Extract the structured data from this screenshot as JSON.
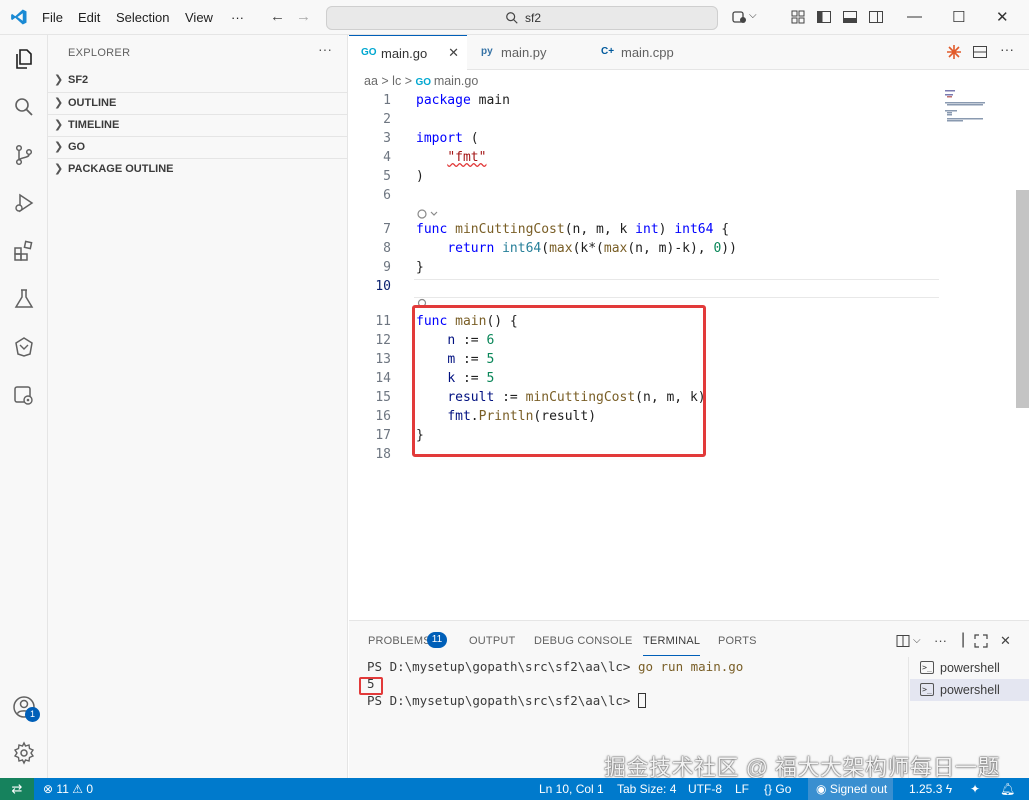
{
  "menu": {
    "file": "File",
    "edit": "Edit",
    "selection": "Selection",
    "view": "View",
    "more": "···"
  },
  "search": {
    "text": "sf2"
  },
  "sidebar": {
    "title": "EXPLORER",
    "sections": [
      "SF2",
      "OUTLINE",
      "TIMELINE",
      "GO",
      "PACKAGE OUTLINE"
    ]
  },
  "tabs": [
    {
      "label": "main.go",
      "icon": "GO"
    },
    {
      "label": "main.py",
      "icon": "py"
    },
    {
      "label": "main.cpp",
      "icon": "C+"
    }
  ],
  "breadcrumb": {
    "folder1": "aa",
    "folder2": "lc",
    "file": "main.go"
  },
  "editor": {
    "line_numbers": [
      "1",
      "2",
      "3",
      "4",
      "5",
      "6",
      "7",
      "8",
      "9",
      "10",
      "11",
      "12",
      "13",
      "14",
      "15",
      "16",
      "17",
      "18"
    ],
    "current_line": "10",
    "code": {
      "l1_kw": "package",
      "l1_rest": " main",
      "l3_kw": "import",
      "l3_rest": " (",
      "l4_str": "\"fmt\"",
      "l5": ")",
      "l7_kw": "func",
      "l7_fn": "minCuttingCost",
      "l7_args": "(n, m, k ",
      "l7_ty": "int",
      "l7_close": ") ",
      "l7_ret": "int64",
      "l7_brace": " {",
      "l8_kw": "return",
      "l8_ty": "int64",
      "l8_a": "(",
      "l8_fn1": "max",
      "l8_b": "(k*(",
      "l8_fn2": "max",
      "l8_c": "(n, m)-k), ",
      "l8_num": "0",
      "l8_d": "))",
      "l9": "}",
      "l11_kw": "func",
      "l11_fn": "main",
      "l11_rest": "() {",
      "l12_var": "n",
      "l12_op": " := ",
      "l12_num": "6",
      "l13_var": "m",
      "l13_op": " := ",
      "l13_num": "5",
      "l14_var": "k",
      "l14_op": " := ",
      "l14_num": "5",
      "l15_var": "result",
      "l15_op": " := ",
      "l15_fn": "minCuttingCost",
      "l15_rest": "(n, m, k)",
      "l16_pkg": "fmt",
      "l16_dot": ".",
      "l16_fn": "Println",
      "l16_rest": "(result)",
      "l17": "}"
    }
  },
  "panel": {
    "tabs": {
      "problems": "PROBLEMS",
      "output": "OUTPUT",
      "debug": "DEBUG CONSOLE",
      "terminal": "TERMINAL",
      "ports": "PORTS"
    },
    "problems_count": "11",
    "terminal": {
      "prompt1": "PS D:\\mysetup\\gopath\\src\\sf2\\aa\\lc> ",
      "command": "go run main.go",
      "output": "5",
      "prompt2": "PS D:\\mysetup\\gopath\\src\\sf2\\aa\\lc> "
    },
    "terminals": [
      "powershell",
      "powershell"
    ]
  },
  "activity_badge": "1",
  "watermark": "掘金技术社区 @ 福大大架构师每日一题",
  "statusbar": {
    "errors": "11",
    "warnings": "0",
    "position": "Ln 10, Col 1",
    "tab_size": "Tab Size: 4",
    "encoding": "UTF-8",
    "eol": "LF",
    "language": "Go",
    "account": "Signed out",
    "go_version": "1.25.3"
  },
  "colors": {
    "accent": "#005fb8",
    "status_bar": "#007acc",
    "highlight": "#e23a3a"
  }
}
